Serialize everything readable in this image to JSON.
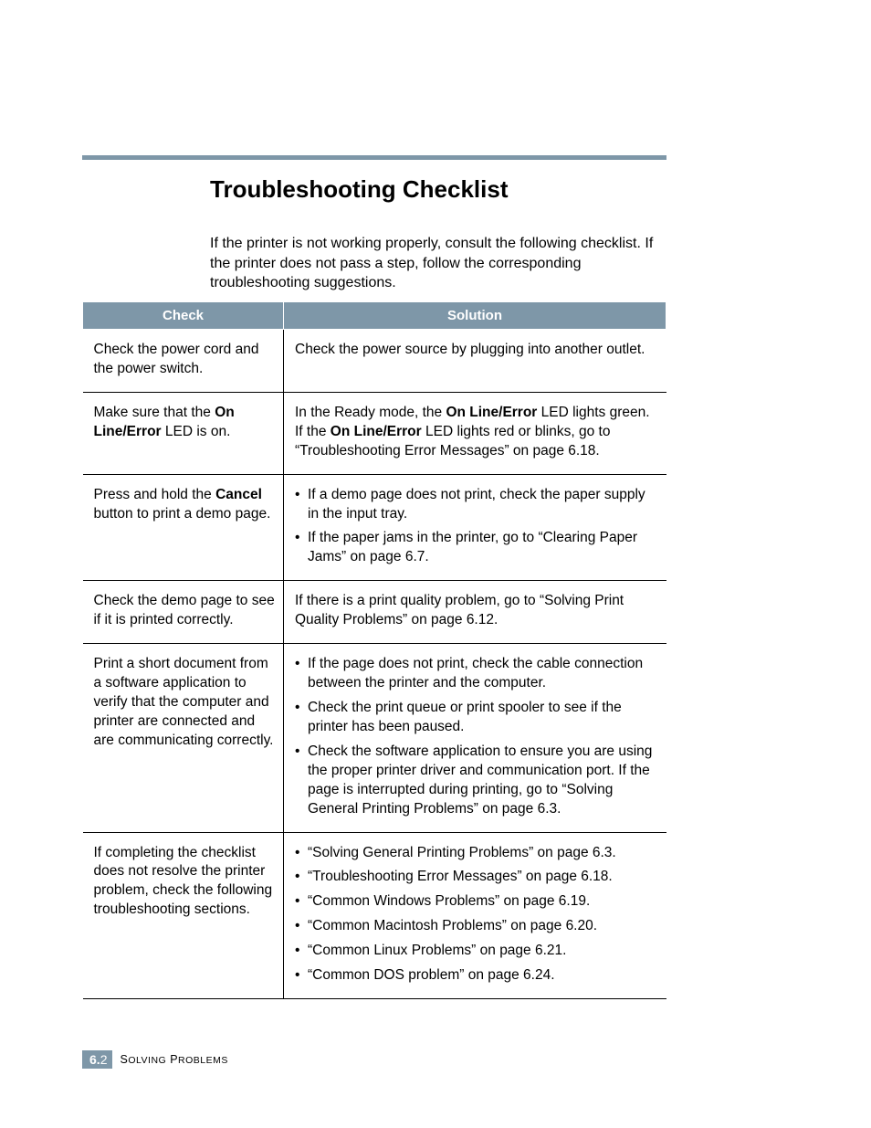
{
  "heading": "Troubleshooting Checklist",
  "intro": "If the printer is not working properly, consult the following checklist. If the printer does not pass a step, follow the corresponding troubleshooting suggestions.",
  "columns": {
    "c1": "Check",
    "c2": "Solution"
  },
  "rows": {
    "r0": {
      "check": [
        [
          "Check the power cord and the power switch.",
          false
        ]
      ],
      "sol": [
        [
          "Check the power source by plugging into another outlet.",
          false
        ]
      ]
    },
    "r1": {
      "check": [
        [
          "Make sure that the ",
          false
        ],
        [
          "On Line/Error",
          true
        ],
        [
          " LED is on.",
          false
        ]
      ],
      "sol": [
        [
          "In the Ready mode, the ",
          false
        ],
        [
          "On Line/Error",
          true
        ],
        [
          " LED lights green. If the ",
          false
        ],
        [
          "On Line/Error",
          true
        ],
        [
          " LED lights red or blinks, go to “Troubleshooting Error Messages” on page 6.18.",
          false
        ]
      ]
    },
    "r2": {
      "check": [
        [
          "Press and hold the ",
          false
        ],
        [
          "Cancel",
          true
        ],
        [
          " button to print a demo page.",
          false
        ]
      ],
      "sol_bullets": [
        "If a demo page does not print, check the paper supply in the input tray.",
        "If the paper jams in the printer, go to “Clearing Paper Jams” on page 6.7."
      ]
    },
    "r3": {
      "check": [
        [
          "Check the demo page to see if it is printed correctly.",
          false
        ]
      ],
      "sol": [
        [
          "If there is a print quality problem, go to “Solving Print Quality Problems” on page 6.12.",
          false
        ]
      ]
    },
    "r4": {
      "check": [
        [
          "Print a short document from a software application to verify that the computer and printer are connected and are communicating correctly.",
          false
        ]
      ],
      "sol_bullets": [
        "If the page does not print, check the cable connection between the printer and the computer.",
        "Check the print queue or print spooler to see if the printer has been paused.",
        "Check the software application to ensure you are using the proper printer driver and communication port. If the page is interrupted during printing, go to “Solving General Printing Problems” on page 6.3."
      ]
    },
    "r5": {
      "check": [
        [
          "If completing the checklist does not resolve the printer problem, check the following troubleshooting sections.",
          false
        ]
      ],
      "sol_bullets": [
        "“Solving General Printing Problems” on page 6.3.",
        "“Troubleshooting Error Messages” on page 6.18.",
        "“Common Windows Problems” on page 6.19.",
        "“Common Macintosh Problems” on page 6.20.",
        "“Common Linux Problems” on page 6.21.",
        "“Common DOS problem” on page 6.24."
      ]
    }
  },
  "footer": {
    "chapter": "6.",
    "page": "2",
    "title_parts": [
      "S",
      "OLVING",
      " P",
      "ROBLEMS"
    ]
  }
}
